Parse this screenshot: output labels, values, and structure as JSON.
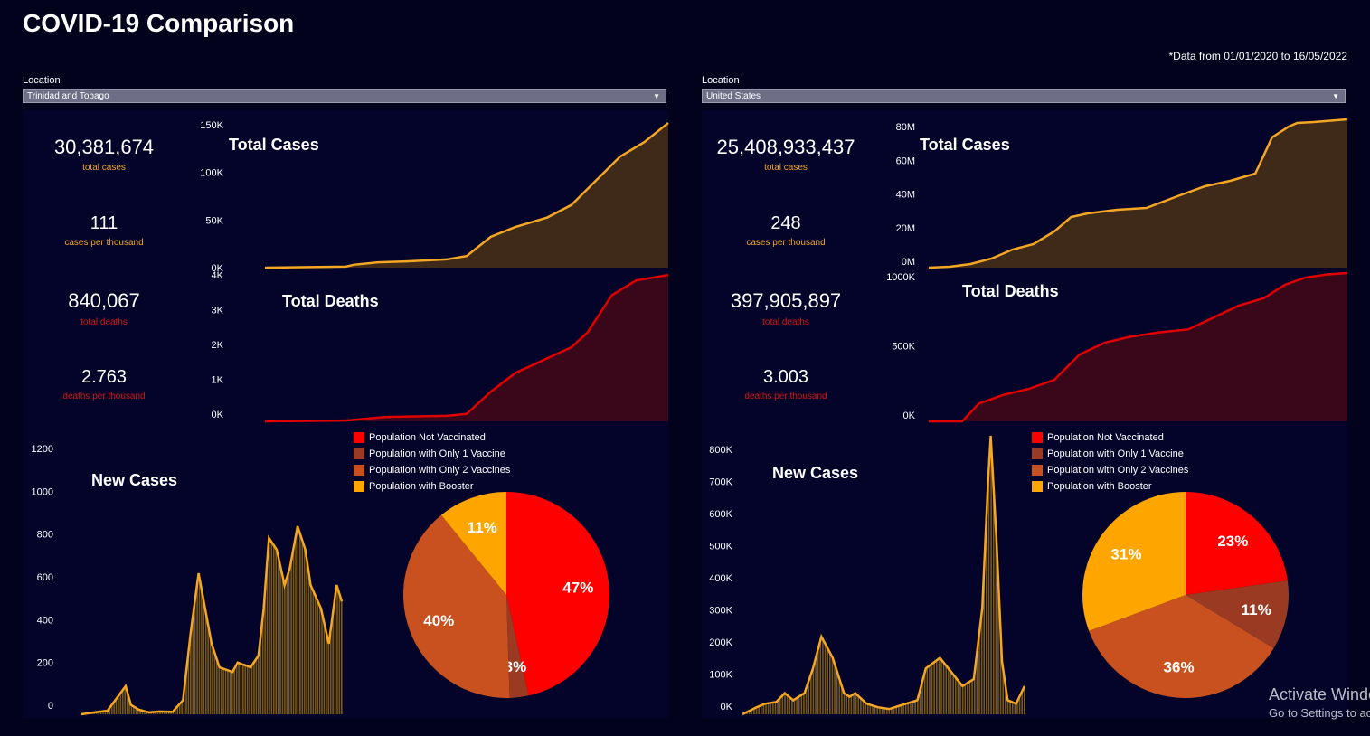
{
  "header": {
    "title": "COVID-19 Comparison",
    "note": "*Data from 01/01/2020 to 16/05/2022"
  },
  "panels": [
    {
      "location_label": "Location",
      "location_value": "Trinidad and Tobago",
      "stats": {
        "total_cases": "30,381,674",
        "total_cases_label": "total cases",
        "cases_per_thousand": "111",
        "cases_per_thousand_label": "cases per thousand",
        "total_deaths": "840,067",
        "total_deaths_label": "total deaths",
        "deaths_per_thousand": "2.763",
        "deaths_per_thousand_label": "deaths per thousand"
      },
      "legend": [
        "Population Not Vaccinated",
        "Population with Only 1 Vaccine",
        "Population with Only 2 Vaccines",
        "Population with Booster"
      ]
    },
    {
      "location_label": "Location",
      "location_value": "United States",
      "stats": {
        "total_cases": "25,408,933,437",
        "total_cases_label": "total cases",
        "cases_per_thousand": "248",
        "cases_per_thousand_label": "cases per thousand",
        "total_deaths": "397,905,897",
        "total_deaths_label": "total deaths",
        "deaths_per_thousand": "3.003",
        "deaths_per_thousand_label": "deaths per thousand"
      },
      "legend": [
        "Population Not Vaccinated",
        "Population with Only 1 Vaccine",
        "Population with Only 2 Vaccines",
        "Population with Booster"
      ]
    }
  ],
  "colors": {
    "background": "#02021c",
    "cases_line": "#f5a623",
    "cases_fill": "#3f2a1a",
    "deaths_line": "#e00000",
    "deaths_fill": "#3a0619",
    "not_vaccinated": "#ff0000",
    "one_vaccine": "#9b3a22",
    "two_vaccines": "#c8511f",
    "booster": "#ffa500"
  },
  "chart_data": [
    {
      "id": "tt-total-cases",
      "type": "area",
      "title": "Total Cases",
      "yticks": [
        "0K",
        "50K",
        "100K",
        "150K"
      ],
      "ylim": [
        0,
        150000
      ],
      "x": [
        0,
        0.2,
        0.22,
        0.28,
        0.35,
        0.45,
        0.5,
        0.56,
        0.62,
        0.7,
        0.76,
        0.82,
        0.88,
        0.94,
        1.0
      ],
      "values": [
        0,
        1000,
        3000,
        5500,
        6500,
        8500,
        12000,
        32000,
        42000,
        52000,
        65000,
        90000,
        115000,
        130000,
        150000
      ]
    },
    {
      "id": "tt-total-deaths",
      "type": "area",
      "title": "Total Deaths",
      "yticks": [
        "0K",
        "1K",
        "2K",
        "3K",
        "4K"
      ],
      "ylim": [
        0,
        4000
      ],
      "x": [
        0,
        0.2,
        0.3,
        0.45,
        0.5,
        0.56,
        0.62,
        0.7,
        0.76,
        0.8,
        0.86,
        0.92,
        1.0
      ],
      "values": [
        0,
        20,
        120,
        150,
        200,
        800,
        1300,
        1700,
        2000,
        2400,
        3400,
        3800,
        3950
      ]
    },
    {
      "id": "tt-new-cases",
      "type": "line",
      "title": "New Cases",
      "yticks": [
        "0",
        "200",
        "400",
        "600",
        "800",
        "1000",
        "1200"
      ],
      "ylim": [
        0,
        1200
      ],
      "x": [
        0,
        0.05,
        0.1,
        0.13,
        0.17,
        0.19,
        0.22,
        0.26,
        0.3,
        0.35,
        0.39,
        0.42,
        0.45,
        0.5,
        0.53,
        0.58,
        0.6,
        0.65,
        0.68,
        0.7,
        0.72,
        0.75,
        0.78,
        0.8,
        0.83,
        0.86,
        0.88,
        0.92,
        0.95,
        0.98,
        1.0
      ],
      "values": [
        0,
        8,
        15,
        60,
        120,
        40,
        20,
        8,
        12,
        10,
        60,
        350,
        600,
        300,
        200,
        180,
        220,
        200,
        250,
        450,
        750,
        700,
        550,
        620,
        800,
        700,
        550,
        450,
        300,
        550,
        480
      ]
    },
    {
      "id": "tt-vaccination",
      "type": "pie",
      "labels": [
        "Population Not Vaccinated",
        "Population with Only 1 Vaccine",
        "Population with Only 2 Vaccines",
        "Population with Booster"
      ],
      "values": [
        47,
        3,
        40,
        11
      ],
      "value_labels": [
        "47%",
        "3%",
        "40%",
        "11%"
      ]
    },
    {
      "id": "us-total-cases",
      "type": "area",
      "title": "Total Cases",
      "yticks": [
        "0M",
        "20M",
        "40M",
        "60M",
        "80M"
      ],
      "ylim": [
        0,
        80000000
      ],
      "x": [
        0,
        0.05,
        0.1,
        0.15,
        0.2,
        0.25,
        0.3,
        0.34,
        0.38,
        0.45,
        0.52,
        0.6,
        0.66,
        0.72,
        0.78,
        0.82,
        0.86,
        0.88,
        0.92,
        1.0
      ],
      "values": [
        0,
        500000,
        2000000,
        5000000,
        10000000,
        13000000,
        20000000,
        28000000,
        30000000,
        32000000,
        33000000,
        40000000,
        45000000,
        48000000,
        52000000,
        72000000,
        78000000,
        80000000,
        80500000,
        82000000
      ]
    },
    {
      "id": "us-total-deaths",
      "type": "area",
      "title": "Total Deaths",
      "yticks": [
        "0K",
        "500K",
        "1000K"
      ],
      "ylim": [
        0,
        1000000
      ],
      "x": [
        0,
        0.08,
        0.12,
        0.18,
        0.24,
        0.3,
        0.36,
        0.42,
        0.48,
        0.55,
        0.62,
        0.68,
        0.74,
        0.8,
        0.85,
        0.9,
        0.95,
        1.0
      ],
      "values": [
        0,
        0,
        120000,
        180000,
        220000,
        280000,
        450000,
        530000,
        570000,
        600000,
        620000,
        700000,
        780000,
        830000,
        920000,
        970000,
        990000,
        1000000
      ]
    },
    {
      "id": "us-new-cases",
      "type": "line",
      "title": "New Cases",
      "yticks": [
        "0K",
        "100K",
        "200K",
        "300K",
        "400K",
        "500K",
        "600K",
        "700K",
        "800K"
      ],
      "ylim": [
        0,
        800000
      ],
      "x": [
        0,
        0.05,
        0.08,
        0.12,
        0.15,
        0.18,
        0.22,
        0.25,
        0.28,
        0.32,
        0.36,
        0.38,
        0.4,
        0.44,
        0.48,
        0.52,
        0.56,
        0.62,
        0.65,
        0.7,
        0.74,
        0.78,
        0.82,
        0.85,
        0.87,
        0.88,
        0.9,
        0.92,
        0.94,
        0.97,
        1.0
      ],
      "values": [
        0,
        20000,
        30000,
        35000,
        60000,
        40000,
        60000,
        130000,
        220000,
        160000,
        60000,
        50000,
        60000,
        30000,
        20000,
        15000,
        25000,
        40000,
        130000,
        160000,
        120000,
        80000,
        100000,
        300000,
        650000,
        790000,
        500000,
        150000,
        40000,
        30000,
        80000
      ]
    },
    {
      "id": "us-vaccination",
      "type": "pie",
      "labels": [
        "Population Not Vaccinated",
        "Population with Only 1 Vaccine",
        "Population with Only 2 Vaccines",
        "Population with Booster"
      ],
      "values": [
        23,
        11,
        36,
        31
      ],
      "value_labels": [
        "23%",
        "11%",
        "36%",
        "31%"
      ]
    }
  ],
  "watermark": {
    "line1": "Activate Windows",
    "line2": "Go to Settings to activate Windows."
  }
}
